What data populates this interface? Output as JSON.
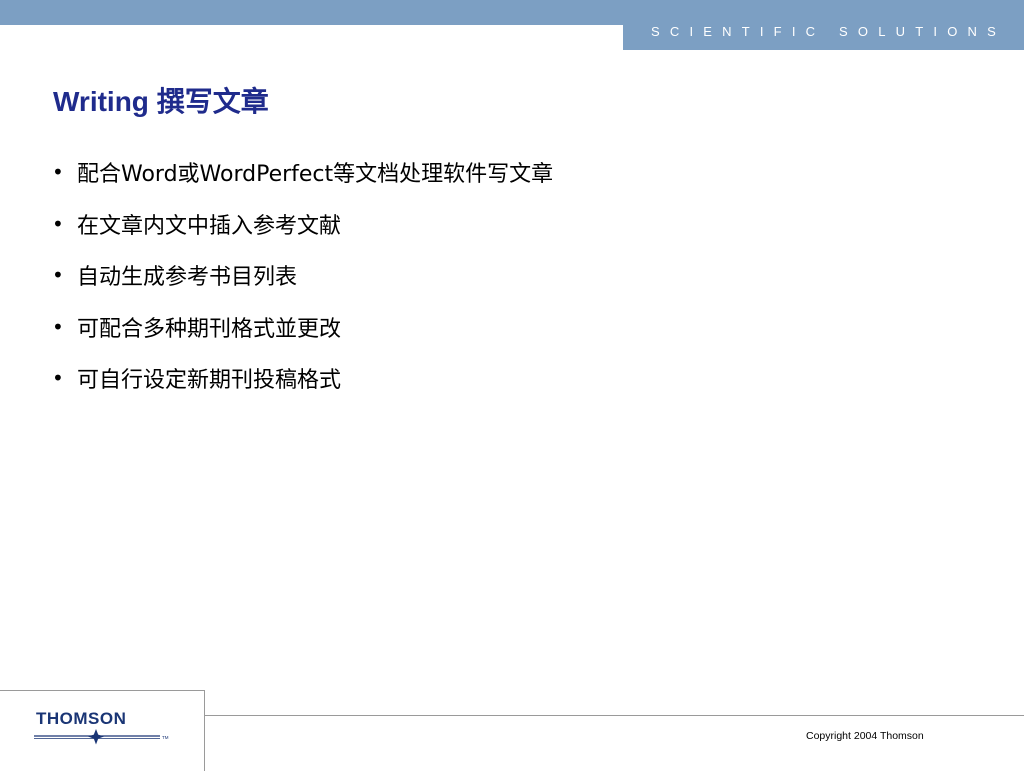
{
  "header": {
    "brand_text": "SCIENTIFIC  SOLUTIONS"
  },
  "slide": {
    "title": "Writing 撰写文章",
    "bullets": [
      "配合Word或WordPerfect等文档处理软件写文章",
      "在文章内文中插入参考文献",
      "自动生成参考书目列表",
      "可配合多种期刊格式並更改",
      "可自行设定新期刊投稿格式"
    ],
    "bullet_symbol": "•"
  },
  "footer": {
    "logo_text": "THOMSON",
    "logo_tm": "TM",
    "copyright": "Copyright 2004 Thomson"
  },
  "colors": {
    "band": "#7c9fc3",
    "title": "#1f2b8c",
    "logo": "#1a3575"
  },
  "icons": {
    "logo_star": "thomson-star-icon"
  }
}
